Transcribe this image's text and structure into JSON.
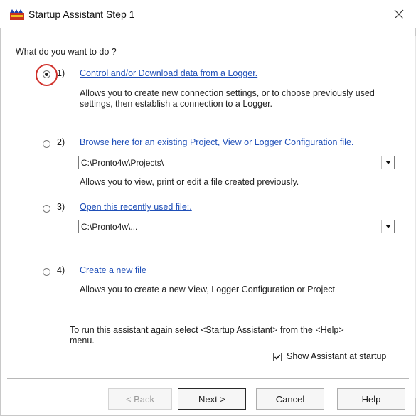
{
  "window": {
    "title": "Startup Assistant Step 1"
  },
  "prompt": "What do you want to do ?",
  "options": [
    {
      "number": "1)",
      "link": "Control and/or Download data from a Logger.",
      "description": "Allows you to create new connection settings, or to choose previously used settings, then establish a connection to a Logger.",
      "selected": true
    },
    {
      "number": "2)",
      "link": "Browse here for an existing Project, View or Logger Configuration file.",
      "path": "C:\\Pronto4w\\Projects\\",
      "description": "Allows you to view, print or edit a file created previously.",
      "selected": false
    },
    {
      "number": "3)",
      "link": "Open this recently used file:.",
      "path": "C:\\Pronto4w\\...",
      "selected": false
    },
    {
      "number": "4)",
      "link": "Create a new file",
      "description": "Allows you to create a new View, Logger Configuration or Project",
      "selected": false
    }
  ],
  "hint": "To run this assistant again select <Startup Assistant> from the <Help> menu.",
  "show_at_startup": {
    "label": "Show Assistant at startup",
    "checked": true
  },
  "buttons": {
    "back": "< Back",
    "next": "Next >",
    "cancel": "Cancel",
    "help": "Help"
  },
  "colors": {
    "link": "#1f4fb8",
    "highlight_ring": "#d0302a"
  }
}
